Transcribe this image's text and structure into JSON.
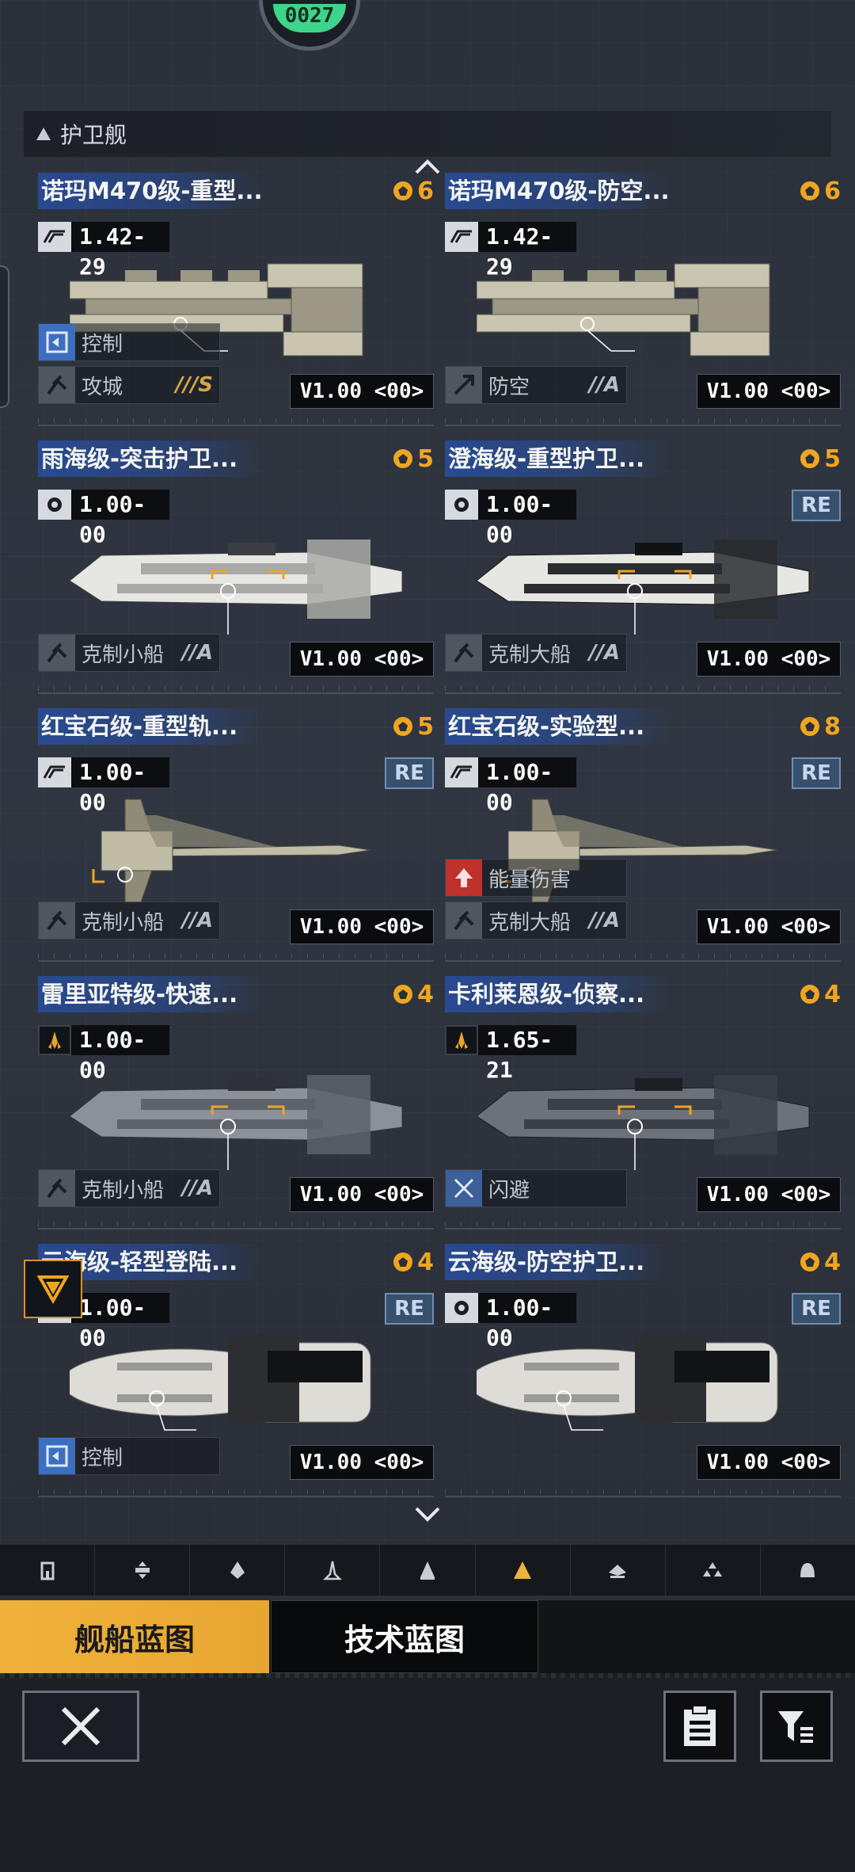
{
  "header": {
    "top_badge_text": "0027",
    "section_title": "护卫舰"
  },
  "cards": [
    {
      "title": "诺玛M470级-重型...",
      "cost": "6",
      "stat_icon": "stealth-icon",
      "stat_value": "1.42-29",
      "re": "",
      "tags": [
        {
          "icon": "control-icon",
          "label": "控制",
          "grade": ""
        },
        {
          "icon": "siege-icon",
          "label": "攻城",
          "grade": "///S"
        }
      ],
      "version": "V1.00 <00>"
    },
    {
      "title": "诺玛M470级-防空...",
      "cost": "6",
      "stat_icon": "stealth-icon",
      "stat_value": "1.42-29",
      "re": "",
      "tags": [
        {
          "icon": "antiair-icon",
          "label": "防空",
          "grade": "//A"
        }
      ],
      "version": "V1.00 <00>"
    },
    {
      "title": "雨海级-突击护卫...",
      "cost": "5",
      "stat_icon": "gear-icon",
      "stat_value": "1.00-00",
      "re": "",
      "tags": [
        {
          "icon": "counter-icon",
          "label": "克制小船",
          "grade": "//A"
        }
      ],
      "version": "V1.00 <00>"
    },
    {
      "title": "澄海级-重型护卫...",
      "cost": "5",
      "stat_icon": "gear-icon",
      "stat_value": "1.00-00",
      "re": "RE",
      "tags": [
        {
          "icon": "counter-icon",
          "label": "克制大船",
          "grade": "//A"
        }
      ],
      "version": "V1.00 <00>"
    },
    {
      "title": "红宝石级-重型轨...",
      "cost": "5",
      "stat_icon": "stealth-icon",
      "stat_value": "1.00-00",
      "re": "RE",
      "tags": [
        {
          "icon": "counter-icon",
          "label": "克制小船",
          "grade": "//A"
        }
      ],
      "version": "V1.00 <00>"
    },
    {
      "title": "红宝石级-实验型...",
      "cost": "8",
      "stat_icon": "stealth-icon",
      "stat_value": "1.00-00",
      "re": "RE",
      "tags": [
        {
          "icon": "energy-icon",
          "label": "能量伤害",
          "grade": ""
        },
        {
          "icon": "counter-icon",
          "label": "克制大船",
          "grade": "//A"
        }
      ],
      "version": "V1.00 <00>"
    },
    {
      "title": "雷里亚特级-快速...",
      "cost": "4",
      "stat_icon": "rocket-icon",
      "stat_value": "1.00-00",
      "re": "",
      "tags": [
        {
          "icon": "counter-icon",
          "label": "克制小船",
          "grade": "//A"
        }
      ],
      "version": "V1.00 <00>"
    },
    {
      "title": "卡利莱恩级-侦察...",
      "cost": "4",
      "stat_icon": "rocket-icon",
      "stat_value": "1.65-21",
      "re": "",
      "tags": [
        {
          "icon": "evade-icon",
          "label": "闪避",
          "grade": ""
        }
      ],
      "version": "V1.00 <00>"
    },
    {
      "title": "云海级-轻型登陆...",
      "cost": "4",
      "stat_icon": "gear-icon",
      "stat_value": "1.00-00",
      "re": "RE",
      "tags": [
        {
          "icon": "control-icon",
          "label": "控制",
          "grade": ""
        }
      ],
      "version": "V1.00 <00>"
    },
    {
      "title": "云海级-防空护卫...",
      "cost": "4",
      "stat_icon": "gear-icon",
      "stat_value": "1.00-00",
      "re": "RE",
      "tags": [],
      "version": "V1.00 <00>"
    }
  ],
  "categories": [
    "tower-icon",
    "cross-icon",
    "ship-icon",
    "fighter-icon",
    "corvette-icon",
    "frigate-icon",
    "destroyer-icon",
    "cluster-icon",
    "dome-icon"
  ],
  "active_category": "frigate-icon",
  "blueprint_tabs": {
    "ship": "舰船蓝图",
    "tech": "技术蓝图"
  },
  "colors": {
    "accent": "#f0b23c",
    "cost": "#f0a521",
    "title_bg": "#284ea0",
    "re_badge": "#36506e"
  }
}
